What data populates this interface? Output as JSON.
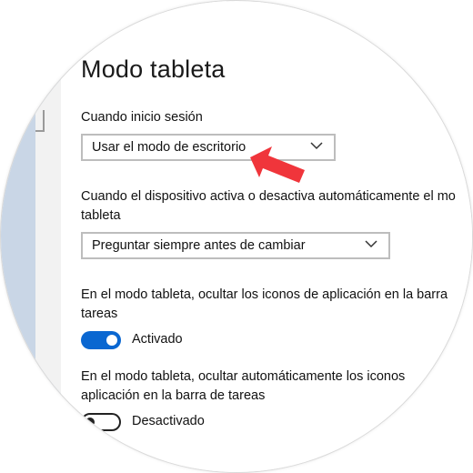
{
  "page": {
    "title": "Modo tableta"
  },
  "signin": {
    "label": "Cuando inicio sesión",
    "dropdown_value": "Usar el modo de escritorio"
  },
  "auto_switch": {
    "label_line1": "Cuando el dispositivo activa o desactiva automáticamente el mo",
    "label_line2": "tableta",
    "dropdown_value": "Preguntar siempre antes de cambiar"
  },
  "hide_icons": {
    "label_line1": "En el modo tableta, ocultar los iconos de aplicación en la barra",
    "label_line2": "tareas",
    "toggle_state": "Activado"
  },
  "auto_hide_icons": {
    "label_line1": "En el modo tableta, ocultar automáticamente los iconos",
    "label_line2": "aplicación en la barra de tareas",
    "toggle_state": "Desactivado"
  },
  "colors": {
    "accent": "#0a67d1",
    "annotation_arrow": "#f0353b",
    "sidebar": "#c9d6e6"
  },
  "icons": {
    "dropdown": "chevron-down-icon",
    "annotation": "red-arrow-icon"
  }
}
